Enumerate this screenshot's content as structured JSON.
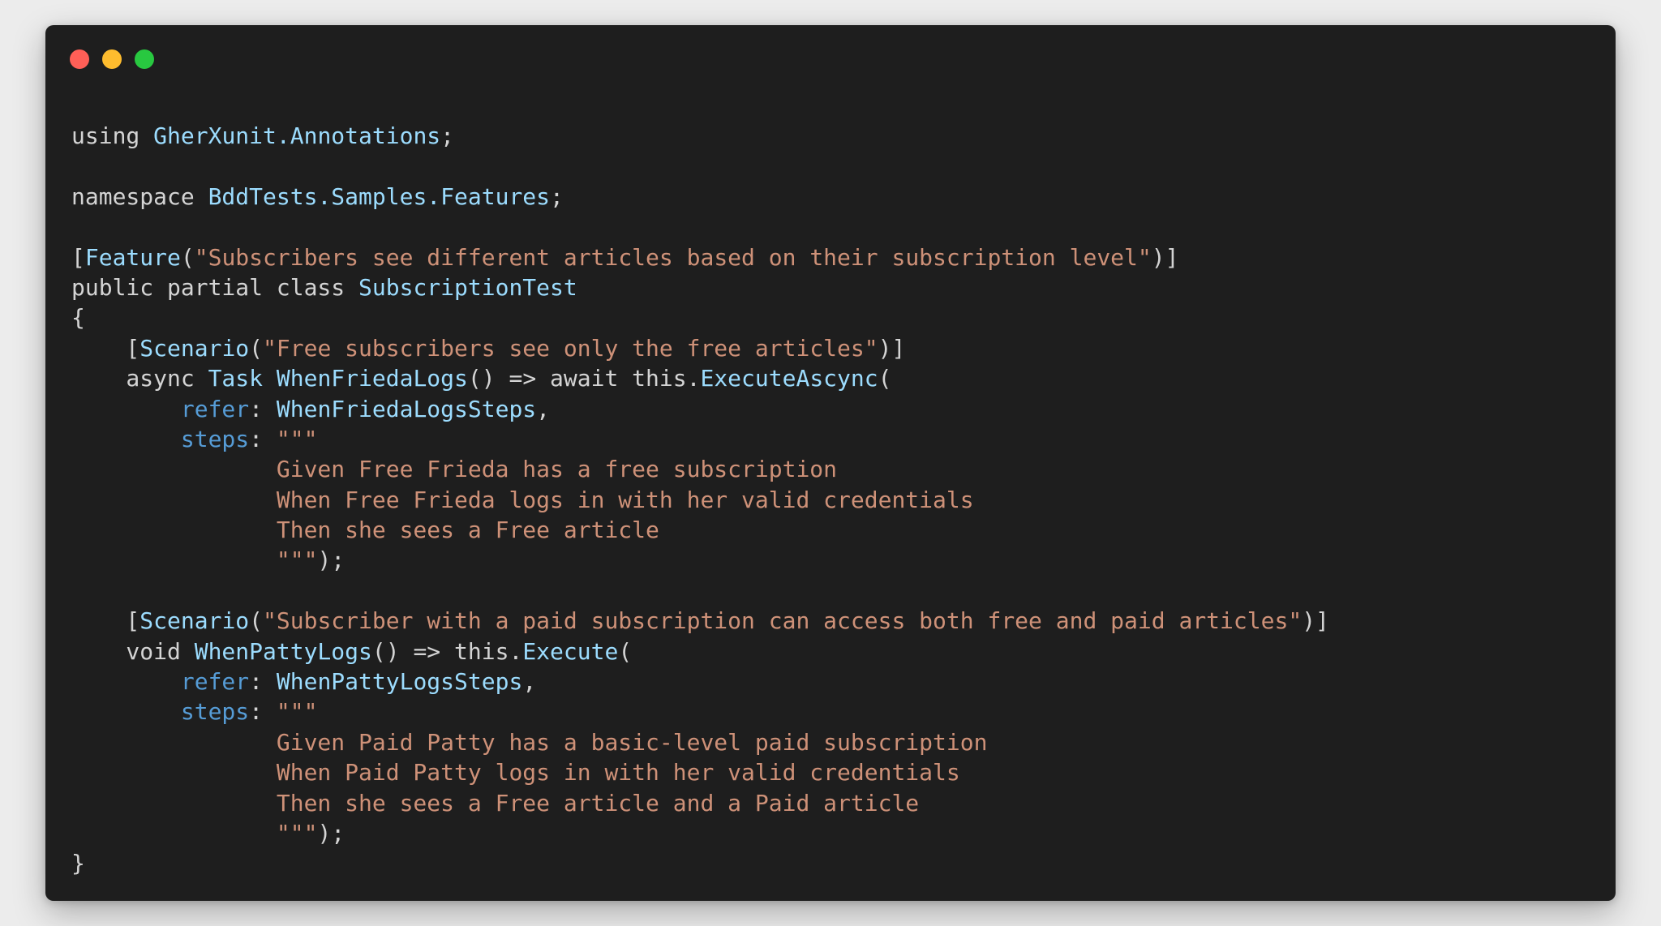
{
  "window": {
    "controls": {
      "close_color": "#ff5f57",
      "minimize_color": "#febc2e",
      "zoom_color": "#28c840"
    }
  },
  "code": {
    "language": "C#",
    "lines": [
      [
        {
          "t": "using ",
          "c": "plain"
        },
        {
          "t": "GherXunit.Annotations",
          "c": "type"
        },
        {
          "t": ";",
          "c": "plain"
        }
      ],
      [],
      [
        {
          "t": "namespace ",
          "c": "plain"
        },
        {
          "t": "BddTests.Samples.Features",
          "c": "type"
        },
        {
          "t": ";",
          "c": "plain"
        }
      ],
      [],
      [
        {
          "t": "[",
          "c": "plain"
        },
        {
          "t": "Feature",
          "c": "type"
        },
        {
          "t": "(",
          "c": "plain"
        },
        {
          "t": "\"Subscribers see different articles based on their subscription level\"",
          "c": "str"
        },
        {
          "t": ")]",
          "c": "plain"
        }
      ],
      [
        {
          "t": "public partial class ",
          "c": "plain"
        },
        {
          "t": "SubscriptionTest",
          "c": "type"
        }
      ],
      [
        {
          "t": "{",
          "c": "plain"
        }
      ],
      [
        {
          "t": "    [",
          "c": "plain"
        },
        {
          "t": "Scenario",
          "c": "type"
        },
        {
          "t": "(",
          "c": "plain"
        },
        {
          "t": "\"Free subscribers see only the free articles\"",
          "c": "str"
        },
        {
          "t": ")]",
          "c": "plain"
        }
      ],
      [
        {
          "t": "    async ",
          "c": "plain"
        },
        {
          "t": "Task",
          "c": "type"
        },
        {
          "t": " ",
          "c": "plain"
        },
        {
          "t": "WhenFriedaLogs",
          "c": "type"
        },
        {
          "t": "() => await this.",
          "c": "plain"
        },
        {
          "t": "ExecuteAscync",
          "c": "type"
        },
        {
          "t": "(",
          "c": "plain"
        }
      ],
      [
        {
          "t": "        ",
          "c": "plain"
        },
        {
          "t": "refer",
          "c": "key"
        },
        {
          "t": ": ",
          "c": "plain"
        },
        {
          "t": "WhenFriedaLogsSteps",
          "c": "type"
        },
        {
          "t": ",",
          "c": "plain"
        }
      ],
      [
        {
          "t": "        ",
          "c": "plain"
        },
        {
          "t": "steps",
          "c": "key"
        },
        {
          "t": ": ",
          "c": "plain"
        },
        {
          "t": "\"\"\"",
          "c": "str"
        }
      ],
      [
        {
          "t": "               Given Free Frieda has a free subscription",
          "c": "str"
        }
      ],
      [
        {
          "t": "               When Free Frieda logs in with her valid credentials",
          "c": "str"
        }
      ],
      [
        {
          "t": "               Then she sees a Free article",
          "c": "str"
        }
      ],
      [
        {
          "t": "               \"\"\"",
          "c": "str"
        },
        {
          "t": ");",
          "c": "plain"
        }
      ],
      [],
      [
        {
          "t": "    [",
          "c": "plain"
        },
        {
          "t": "Scenario",
          "c": "type"
        },
        {
          "t": "(",
          "c": "plain"
        },
        {
          "t": "\"Subscriber with a paid subscription can access both free and paid articles\"",
          "c": "str"
        },
        {
          "t": ")]",
          "c": "plain"
        }
      ],
      [
        {
          "t": "    void ",
          "c": "plain"
        },
        {
          "t": "WhenPattyLogs",
          "c": "type"
        },
        {
          "t": "() => this.",
          "c": "plain"
        },
        {
          "t": "Execute",
          "c": "type"
        },
        {
          "t": "(",
          "c": "plain"
        }
      ],
      [
        {
          "t": "        ",
          "c": "plain"
        },
        {
          "t": "refer",
          "c": "key"
        },
        {
          "t": ": ",
          "c": "plain"
        },
        {
          "t": "WhenPattyLogsSteps",
          "c": "type"
        },
        {
          "t": ",",
          "c": "plain"
        }
      ],
      [
        {
          "t": "        ",
          "c": "plain"
        },
        {
          "t": "steps",
          "c": "key"
        },
        {
          "t": ": ",
          "c": "plain"
        },
        {
          "t": "\"\"\"",
          "c": "str"
        }
      ],
      [
        {
          "t": "               Given Paid Patty has a basic-level paid subscription",
          "c": "str"
        }
      ],
      [
        {
          "t": "               When Paid Patty logs in with her valid credentials",
          "c": "str"
        }
      ],
      [
        {
          "t": "               Then she sees a Free article and a Paid article",
          "c": "str"
        }
      ],
      [
        {
          "t": "               \"\"\"",
          "c": "str"
        },
        {
          "t": ");",
          "c": "plain"
        }
      ],
      [
        {
          "t": "}",
          "c": "plain"
        }
      ]
    ]
  }
}
